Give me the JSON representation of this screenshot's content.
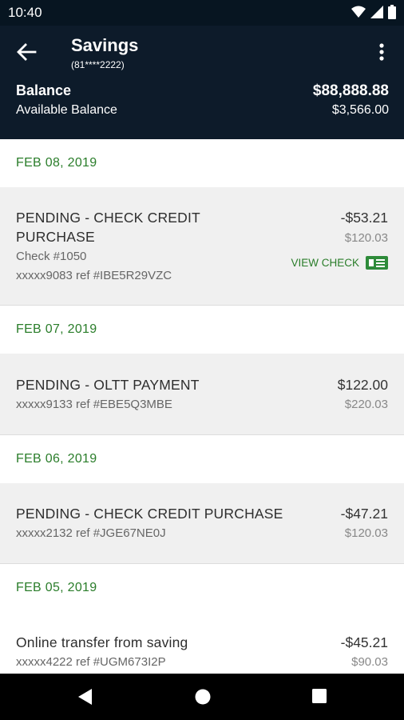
{
  "status": {
    "time": "10:40"
  },
  "header": {
    "title": "Savings",
    "account": "(81****2222)",
    "balance_label": "Balance",
    "balance_value": "$88,888.88",
    "available_label": "Available Balance",
    "available_value": "$3,566.00"
  },
  "groups": [
    {
      "date": "FEB 08, 2019",
      "transactions": [
        {
          "desc_line1": "PENDING - CHECK CREDIT",
          "desc_line2": "PURCHASE",
          "check": "Check #1050",
          "ref": "xxxxx9083 ref #IBE5R29VZC",
          "amount": "-$53.21",
          "balance": "$120.03",
          "view_check": "VIEW CHECK"
        }
      ]
    },
    {
      "date": "FEB 07, 2019",
      "transactions": [
        {
          "desc": "PENDING - OLTT PAYMENT",
          "ref": "xxxxx9133 ref #EBE5Q3MBE",
          "amount": "$122.00",
          "balance": "$220.03"
        }
      ]
    },
    {
      "date": "FEB 06, 2019",
      "transactions": [
        {
          "desc": "PENDING - CHECK CREDIT PURCHASE",
          "ref": "xxxxx2132 ref #JGE67NE0J",
          "amount": "-$47.21",
          "balance": "$120.03"
        }
      ]
    },
    {
      "date": "FEB 05, 2019",
      "transactions": [
        {
          "desc": "Online transfer from saving",
          "ref": "xxxxx4222 ref #UGM673I2P",
          "amount": "-$45.21",
          "balance": "$90.03"
        }
      ]
    }
  ],
  "colors": {
    "header_bg": "#0d1b2a",
    "accent_green": "#2a7d2a"
  }
}
